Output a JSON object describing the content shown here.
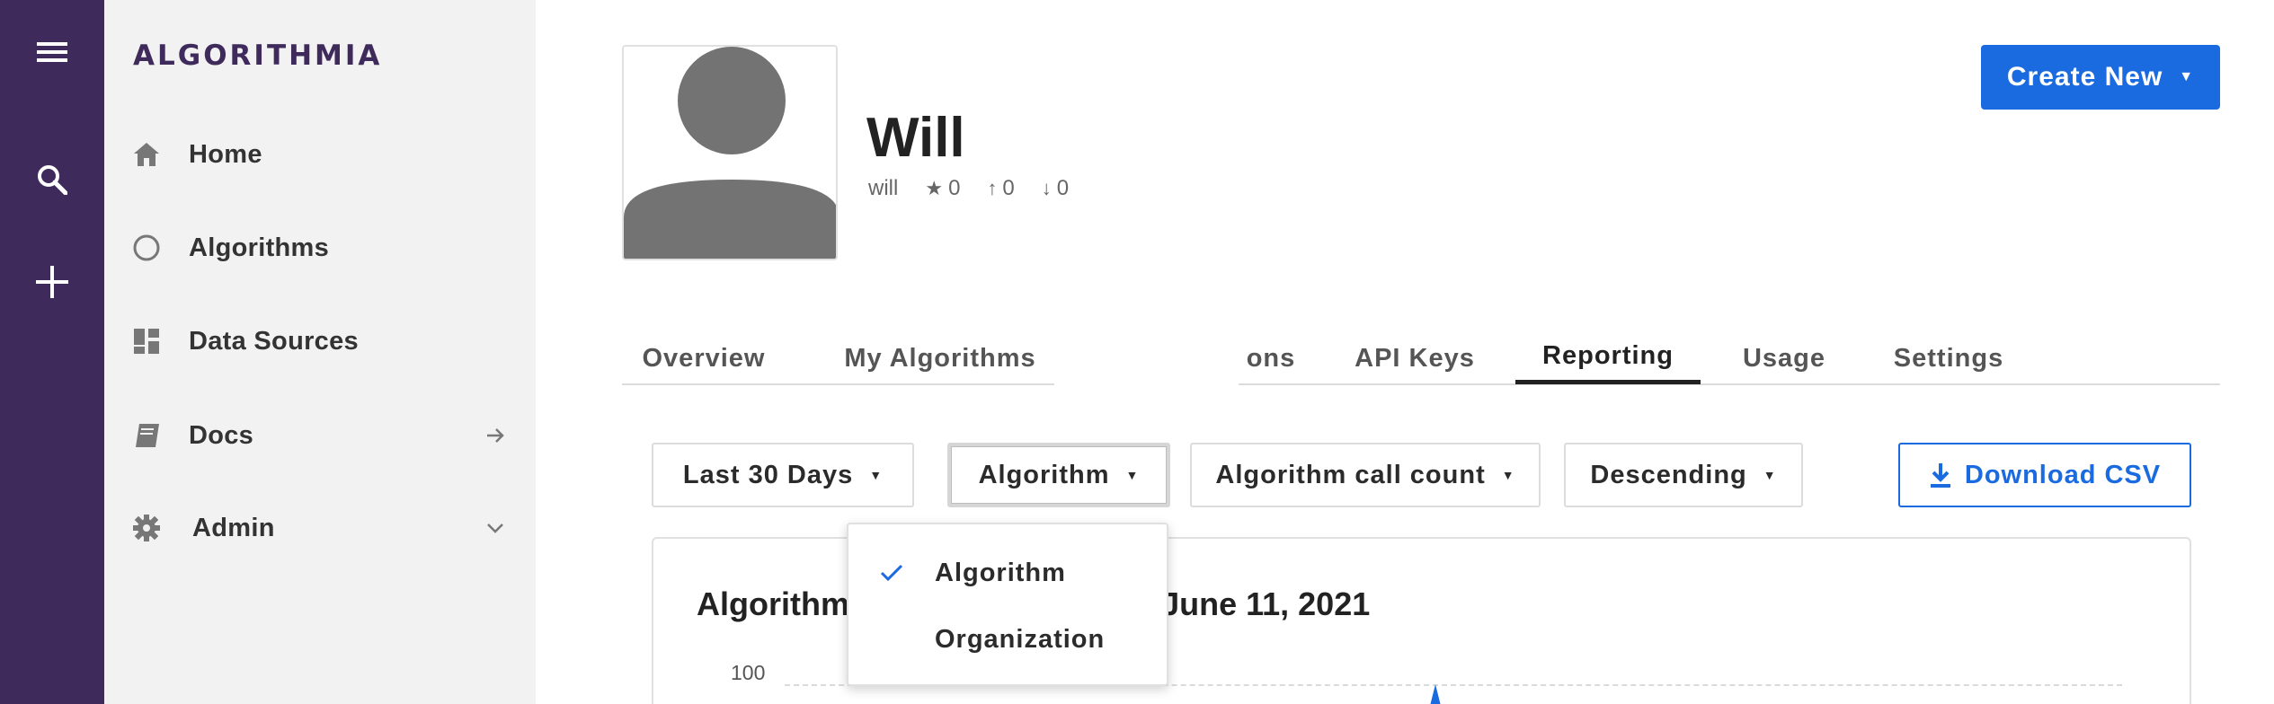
{
  "brand": {
    "logo": "ALGORITHMIA"
  },
  "rail": {
    "icons": [
      "menu-icon",
      "search-icon",
      "plus-icon"
    ]
  },
  "sidebar": {
    "items": [
      {
        "label": "Home",
        "icon": "home-icon"
      },
      {
        "label": "Algorithms",
        "icon": "circle-icon"
      },
      {
        "label": "Data Sources",
        "icon": "data-sources-icon"
      },
      {
        "label": "Docs",
        "icon": "book-icon",
        "trailing": "arrow-right-icon"
      },
      {
        "label": "Admin",
        "icon": "gear-icon",
        "trailing": "chevron-down-icon"
      }
    ]
  },
  "profile": {
    "name": "Will",
    "username": "will",
    "stars": "0",
    "upvotes": "0",
    "downvotes": "0"
  },
  "header": {
    "create_label": "Create New"
  },
  "tabs": [
    {
      "label": "Overview"
    },
    {
      "label": "My Algorithms"
    },
    {
      "label": "ons"
    },
    {
      "label": "API Keys"
    },
    {
      "label": "Reporting",
      "active": true
    },
    {
      "label": "Usage"
    },
    {
      "label": "Settings"
    }
  ],
  "filters": {
    "range": "Last 30 Days",
    "group_by": "Algorithm",
    "metric": "Algorithm call count",
    "order": "Descending",
    "download": "Download CSV"
  },
  "dropdown": {
    "options": [
      {
        "label": "Algorithm",
        "selected": true
      },
      {
        "label": "Organization",
        "selected": false
      }
    ]
  },
  "chart": {
    "title_left": "Algorithm",
    "title_right": ", 2021 - June 11, 2021",
    "y_tick": "100"
  },
  "colors": {
    "rail": "#3f2a5c",
    "accent": "#1a6ae0",
    "sidebar": "#f2f2f2"
  }
}
